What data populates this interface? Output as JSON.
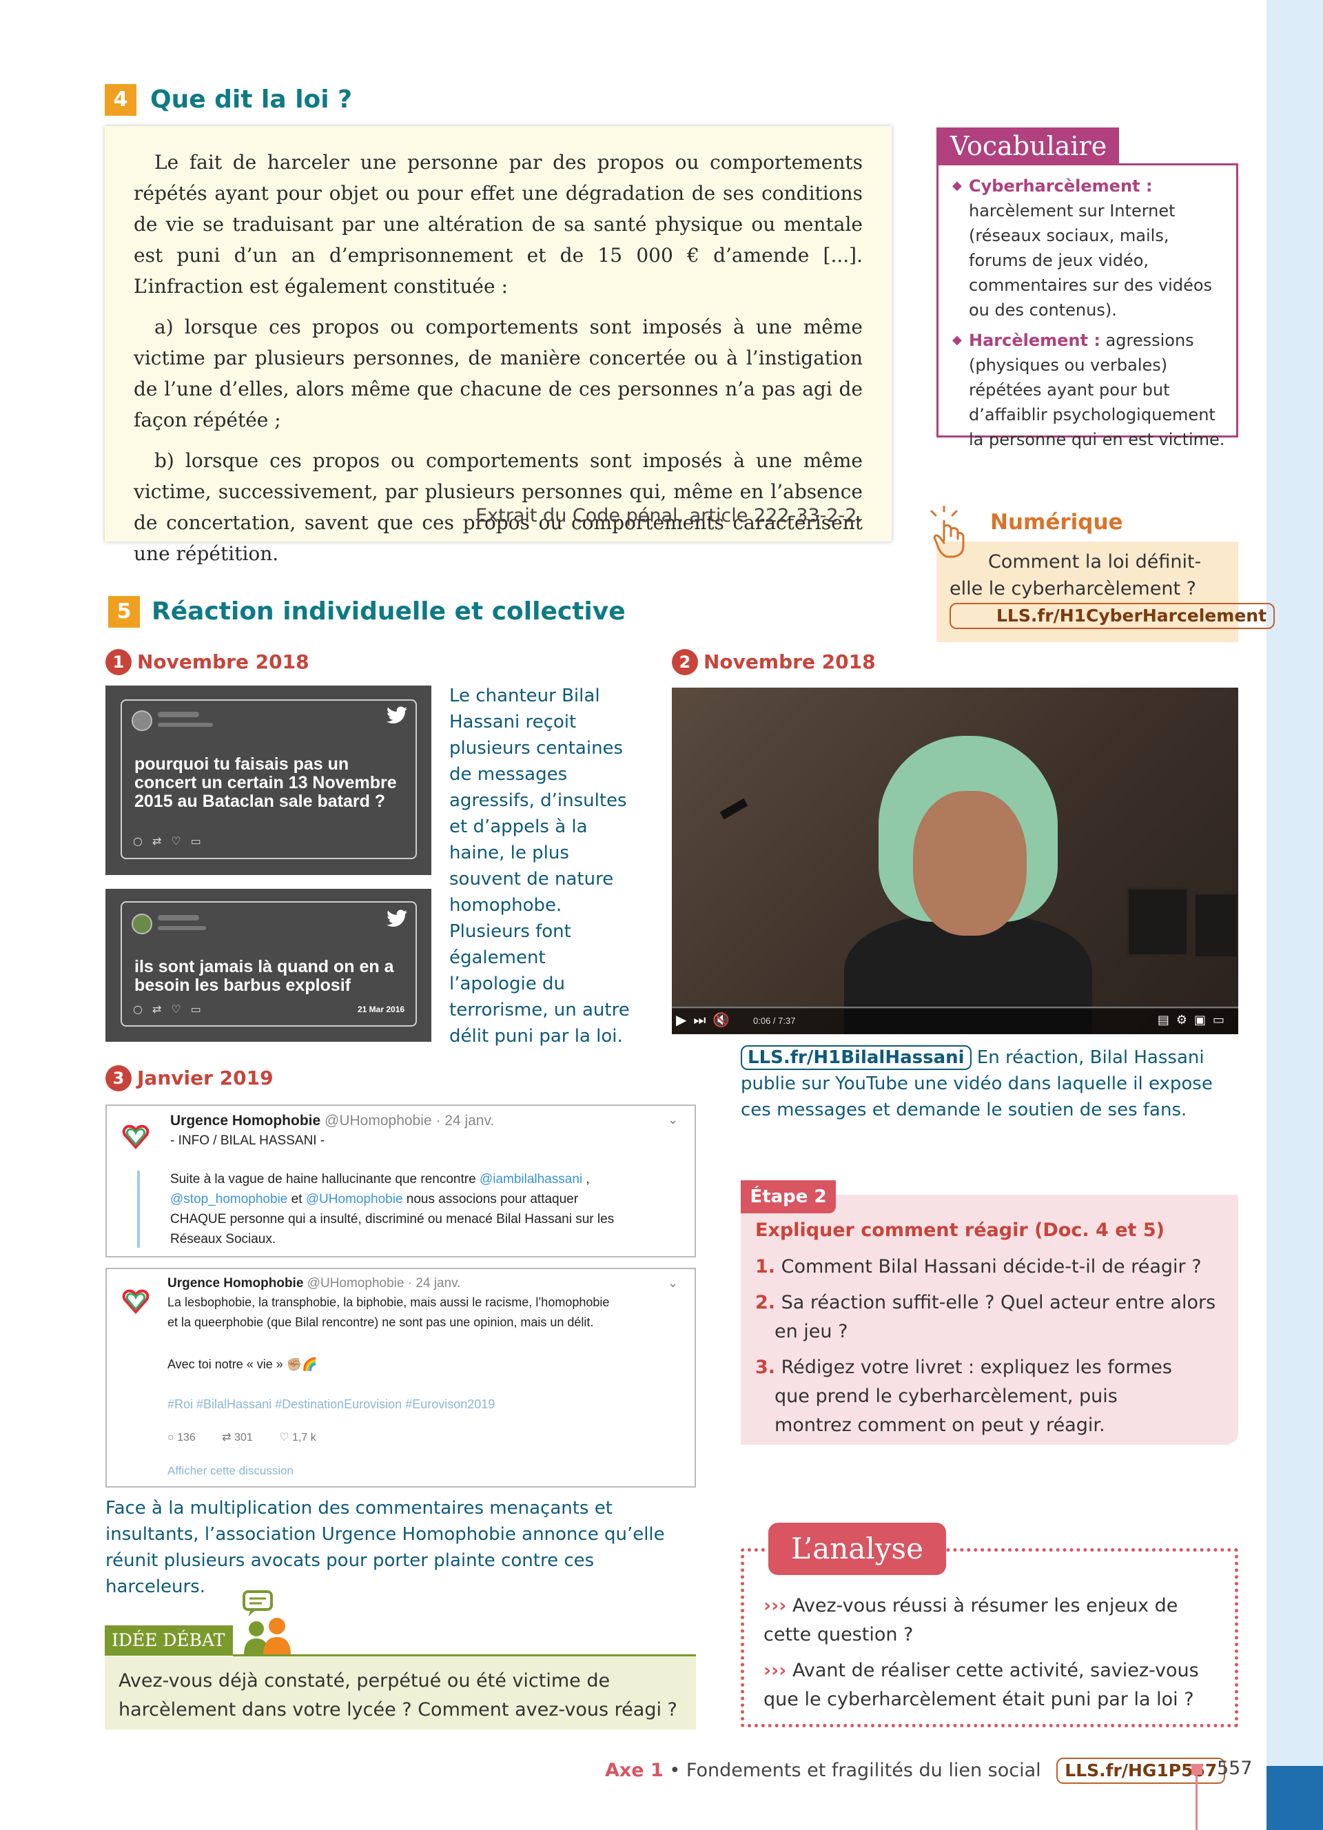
{
  "section4": {
    "number": "4",
    "title": "Que dit la loi ?",
    "paragraphs": [
      "Le fait de harceler une personne par des propos ou comportements répétés ayant pour objet ou pour effet une dégradation de ses conditions de vie se traduisant par une altération de sa santé physique ou mentale est puni d’un an d’emprisonnement et de 15 000 € d’amende [...]. L’infraction est également constituée :",
      "a) lorsque ces propos ou comportements sont imposés à une même victime par plusieurs personnes, de manière concertée ou à l’instigation de l’une d’elles, alors même que chacune de ces personnes n’a pas agi de façon répétée ;",
      "b) lorsque ces propos ou comportements sont imposés à une même victime, successivement, par plusieurs personnes qui, même en l’absence de concertation, savent que ces propos ou comportements caractérisent une répétition."
    ],
    "source": "Extrait du Code pénal, article 222-33-2-2."
  },
  "vocabulary": {
    "title": "Vocabulaire",
    "items": [
      {
        "term": "Cyberharcèlement :",
        "definition": " harcèlement sur Internet (réseaux sociaux, mails, forums de jeux vidéo, commentaires sur des vidéos ou des contenus)."
      },
      {
        "term": "Harcèlement :",
        "definition": " agressions (physiques ou verbales) répétées ayant pour but d’affaiblir psychologiquement la personne qui en est victime."
      }
    ]
  },
  "numerique": {
    "title": "Numérique",
    "text": "Comment la loi définit-elle le cyberharcèlement ?",
    "link": "LLS.fr/H1CyberHarcelement"
  },
  "section5": {
    "number": "5",
    "title": "Réaction individuelle et collective"
  },
  "doc1": {
    "number": "1",
    "date": "Novembre 2018",
    "tweet1": "pourquoi tu faisais pas un concert un certain 13 Novembre 2015 au Bataclan sale batard ?",
    "tweet2": "ils sont jamais là quand on en a besoin les barbus explosif",
    "tweet2_date": "21 Mar 2016",
    "caption": "Le chanteur Bilal Hassani reçoit plusieurs centaines de messages agressifs, d’insultes et d’appels à la haine, le plus souvent de nature homophobe. Plusieurs font également l’apologie du terrorisme, un autre délit puni par la loi."
  },
  "doc2": {
    "number": "2",
    "date": "Novembre 2018",
    "video_time": "0:06 / 7:37",
    "link": "LLS.fr/H1BilalHassani",
    "caption": " En réaction, Bilal Hassani publie sur YouTube une vidéo dans laquelle il expose ces messages et demande le soutien de ses fans."
  },
  "doc3": {
    "number": "3",
    "date": "Janvier 2019",
    "tweetA": {
      "name": "Urgence Homophobie",
      "handle": " @UHomophobie · 24 janv.",
      "line1": "- INFO / BILAL HASSANI -",
      "line2a": "Suite à la vague de haine hallucinante que rencontre ",
      "mention1": "@iambilalhassani",
      "line2b": " ,",
      "mention2": "@stop_homophobie",
      "and": " et ",
      "mention3": "@UHomophobie",
      "line3": "  nous associons pour attaquer",
      "line4": "CHAQUE personne qui a insulté, discriminé ou menacé Bilal Hassani sur les",
      "line5": "Réseaux Sociaux."
    },
    "tweetB": {
      "name": "Urgence Homophobie",
      "handle": " @UHomophobie · 24 janv.",
      "line1": "La lesbophobie, la transphobie, la biphobie, mais aussi le racisme, l’homophobie",
      "line2": "et la queerphobie (que Bilal rencontre) ne sont pas une opinion, mais un délit.",
      "line3": "Avec toi notre « vie » ✊🏼🌈",
      "hashtags": "#Roi #BilalHassani #DestinationEurovision #Eurovison2019",
      "replies": "136",
      "retweets": "301",
      "likes": "1,7 k",
      "show": "Afficher cette discussion"
    },
    "caption": "Face à la multiplication des commentaires menaçants et insultants, l’association Urgence Homophobie annonce qu’elle réunit plusieurs avocats pour porter plainte contre ces harceleurs."
  },
  "etape": {
    "tab": "Étape 2",
    "subtitle": "Expliquer comment réagir (Doc. 4 et 5)",
    "questions": [
      {
        "num": "1.",
        "text": " Comment Bilal Hassani décide-t-il de réagir ?"
      },
      {
        "num": "2.",
        "text": " Sa réaction suffit-elle ? Quel acteur entre alors en jeu ?"
      },
      {
        "num": "3.",
        "text": " Rédigez votre livret : expliquez les formes que prend le cyberharcèlement, puis montrez comment on peut y réagir."
      }
    ]
  },
  "analyse": {
    "title": "L’analyse",
    "items": [
      {
        "marker": "›››",
        "text": " Avez-vous réussi à résumer les enjeux de cette question ?"
      },
      {
        "marker": "›››",
        "text": " Avant de réaliser cette activité, saviez-vous que le cyberharcèlement était puni par la loi ?"
      }
    ]
  },
  "debat": {
    "tag": "IDÉE DÉBAT",
    "text": "Avez-vous déjà constaté, perpétué ou été victime de harcèlement dans votre lycée ? Comment avez-vous réagi ?"
  },
  "footer": {
    "axe": "Axe 1",
    "sep": " • ",
    "title": "Fondements et fragilités du lien social",
    "link": "LLS.fr/HG1P557",
    "page": "557"
  },
  "colors": {
    "accent_teal": "#0e7a85",
    "accent_orange": "#f0a020",
    "accent_red": "#c8443a",
    "accent_magenta": "#b0407e",
    "accent_pink": "#d85561",
    "accent_green": "#7a9a2e"
  },
  "icons": [
    "twitter-bird-icon",
    "reply-icon",
    "retweet-icon",
    "like-icon",
    "message-icon",
    "pointer-hand-icon",
    "debate-people-icon",
    "play-icon",
    "next-icon",
    "mute-icon",
    "settings-icon",
    "fullscreen-icon"
  ]
}
